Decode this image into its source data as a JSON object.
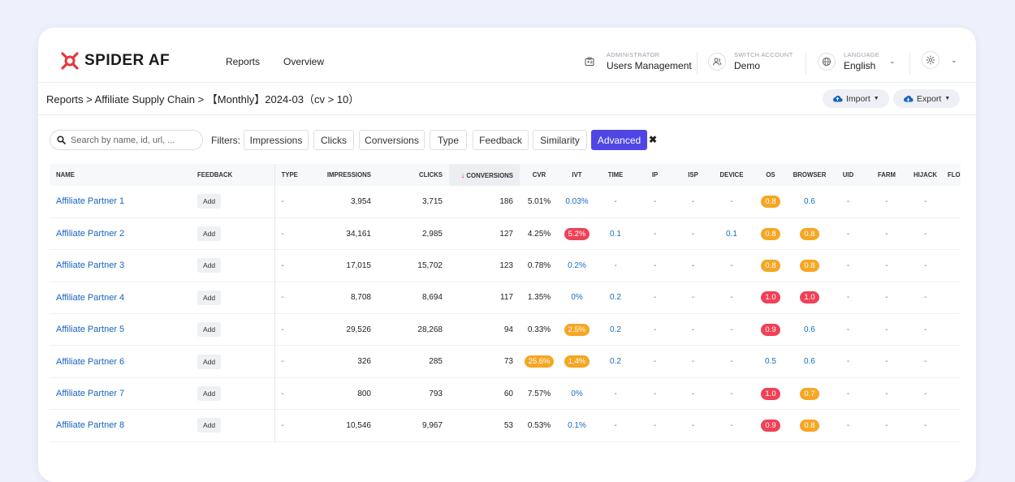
{
  "brand": {
    "name": "SPIDER AF",
    "accent": "#e5383b"
  },
  "nav": [
    "Reports",
    "Overview"
  ],
  "header": {
    "admin": {
      "small": "ADMINISTRATOR",
      "big": "Users Management",
      "icon": "users-management-icon"
    },
    "account": {
      "small": "SWITCH ACCOUNT",
      "big": "Demo",
      "icon": "user-group-icon"
    },
    "language": {
      "small": "LANGUAGE",
      "big": "English",
      "icon": "globe-icon"
    },
    "settings_icon": "gear-icon"
  },
  "breadcrumb": "Reports > Affiliate Supply Chain > 【Monthly】2024-03（cv > 10）",
  "actions": {
    "import": "Import",
    "export": "Export"
  },
  "search": {
    "placeholder": "Search by name, id, url, ..."
  },
  "filters": {
    "label": "Filters:",
    "items": [
      "Impressions",
      "Clicks",
      "Conversions",
      "Type",
      "Feedback",
      "Similarity",
      "Advanced"
    ],
    "active": "Advanced",
    "active_color": "#4f46e5",
    "clear": "✖"
  },
  "table": {
    "columns": [
      "NAME",
      "FEEDBACK",
      "TYPE",
      "IMPRESSIONS",
      "CLICKS",
      "CONVERSIONS",
      "CVR",
      "IVT",
      "TIME",
      "IP",
      "ISP",
      "DEVICE",
      "OS",
      "BROWSER",
      "UID",
      "FARM",
      "HIJACK",
      "FLO"
    ],
    "sorted_column": "CONVERSIONS",
    "sort_arrow": "↓",
    "feedback_label": "Add",
    "badge_colors": {
      "red": "#ef4157",
      "orange": "#f5a623"
    },
    "rows": [
      {
        "name": "Affiliate Partner 1",
        "type": "-",
        "impressions": "3,954",
        "clicks": "3,715",
        "conversions": "186",
        "cvr": "5.01%",
        "ivt": "0.03%",
        "time": "-",
        "ip": "-",
        "isp": "-",
        "device": "-",
        "os": "0.8",
        "browser": "0.6",
        "uid": "-",
        "farm": "-",
        "hijack": "-"
      },
      {
        "name": "Affiliate Partner 2",
        "type": "-",
        "impressions": "34,161",
        "clicks": "2,985",
        "conversions": "127",
        "cvr": "4.25%",
        "ivt": "5.2%",
        "time": "0.1",
        "ip": "-",
        "isp": "-",
        "device": "0.1",
        "os": "0.8",
        "browser": "0.8",
        "uid": "-",
        "farm": "-",
        "hijack": "-"
      },
      {
        "name": "Affiliate Partner 3",
        "type": "-",
        "impressions": "17,015",
        "clicks": "15,702",
        "conversions": "123",
        "cvr": "0.78%",
        "ivt": "0.2%",
        "time": "-",
        "ip": "-",
        "isp": "-",
        "device": "-",
        "os": "0.8",
        "browser": "0.8",
        "uid": "-",
        "farm": "-",
        "hijack": "-"
      },
      {
        "name": "Affiliate Partner 4",
        "type": "-",
        "impressions": "8,708",
        "clicks": "8,694",
        "conversions": "117",
        "cvr": "1.35%",
        "ivt": "0%",
        "time": "0.2",
        "ip": "-",
        "isp": "-",
        "device": "-",
        "os": "1.0",
        "browser": "1.0",
        "uid": "-",
        "farm": "-",
        "hijack": "-"
      },
      {
        "name": "Affiliate Partner 5",
        "type": "-",
        "impressions": "29,526",
        "clicks": "28,268",
        "conversions": "94",
        "cvr": "0.33%",
        "ivt": "2.5%",
        "time": "0.2",
        "ip": "-",
        "isp": "-",
        "device": "-",
        "os": "0.9",
        "browser": "0.6",
        "uid": "-",
        "farm": "-",
        "hijack": "-"
      },
      {
        "name": "Affiliate Partner 6",
        "type": "-",
        "impressions": "326",
        "clicks": "285",
        "conversions": "73",
        "cvr": "25.6%",
        "ivt": "1.4%",
        "time": "0.2",
        "ip": "-",
        "isp": "-",
        "device": "-",
        "os": "0.5",
        "browser": "0.6",
        "uid": "-",
        "farm": "-",
        "hijack": "-"
      },
      {
        "name": "Affiliate Partner 7",
        "type": "-",
        "impressions": "800",
        "clicks": "793",
        "conversions": "60",
        "cvr": "7.57%",
        "ivt": "0%",
        "time": "-",
        "ip": "-",
        "isp": "-",
        "device": "-",
        "os": "1.0",
        "browser": "0.7",
        "uid": "-",
        "farm": "-",
        "hijack": "-"
      },
      {
        "name": "Affiliate Partner 8",
        "type": "-",
        "impressions": "10,546",
        "clicks": "9,967",
        "conversions": "53",
        "cvr": "0.53%",
        "ivt": "0.1%",
        "time": "-",
        "ip": "-",
        "isp": "-",
        "device": "-",
        "os": "0.9",
        "browser": "0.8",
        "uid": "-",
        "farm": "-",
        "hijack": "-"
      }
    ],
    "styles": {
      "cvr": [
        null,
        null,
        null,
        null,
        null,
        "orange",
        null,
        null
      ],
      "ivt": [
        "link",
        "red",
        "link",
        "link",
        "orange",
        "orange",
        "link",
        "link"
      ],
      "os": [
        "orange",
        "orange",
        "orange",
        "red",
        "red",
        "link",
        "red",
        "red"
      ],
      "browser": [
        "link",
        "orange",
        "orange",
        "red",
        "link",
        "link",
        "orange",
        "orange"
      ]
    }
  }
}
